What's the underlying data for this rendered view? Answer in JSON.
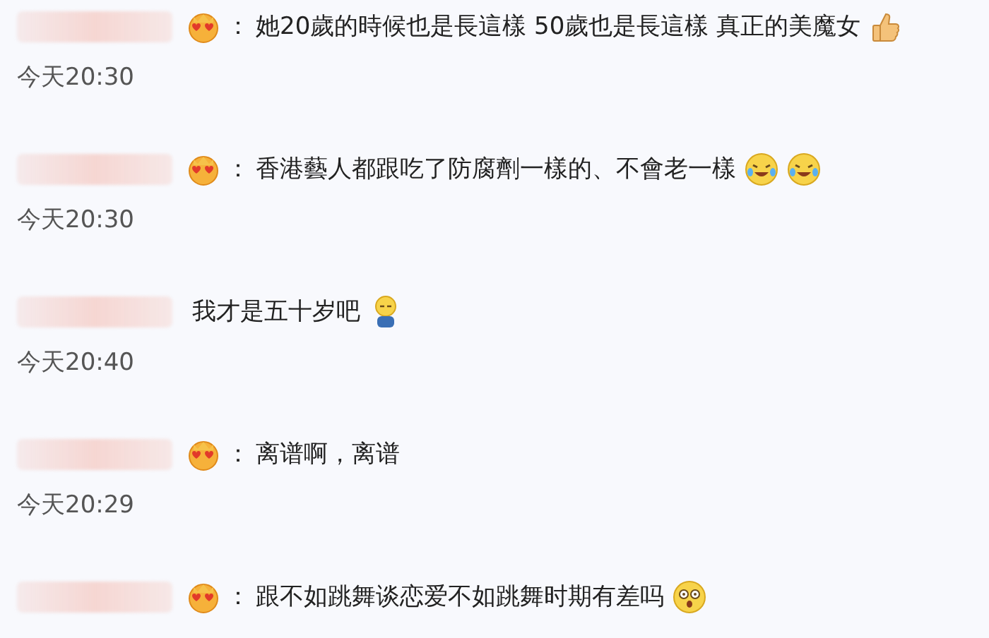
{
  "comments": [
    {
      "badge": true,
      "separator": "：",
      "text": "她20歲的時候也是長這樣 50歲也是長這樣 真正的美魔女",
      "emojis": [
        {
          "kind": "thumbs-up"
        }
      ],
      "time": "今天20:30"
    },
    {
      "badge": true,
      "separator": "：",
      "text": "香港藝人都跟吃了防腐劑一樣的、不會老一樣",
      "emojis": [
        {
          "kind": "laugh-cry"
        },
        {
          "kind": "laugh-cry"
        }
      ],
      "time": "今天20:30"
    },
    {
      "badge": false,
      "text": "我才是五十岁吧",
      "emojis": [
        {
          "kind": "sleepy"
        }
      ],
      "time": "今天20:40"
    },
    {
      "badge": true,
      "separator": "：",
      "text": "离谱啊，离谱",
      "time": "今天20:29"
    },
    {
      "badge": true,
      "separator": "：",
      "text": "跟不如跳舞谈恋爱不如跳舞时期有差吗",
      "emojis": [
        {
          "kind": "dizzy"
        }
      ]
    }
  ]
}
